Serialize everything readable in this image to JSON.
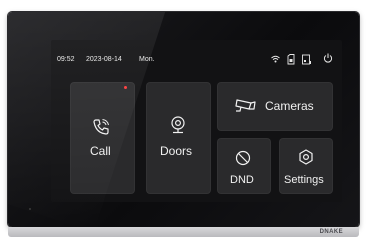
{
  "status_bar": {
    "time": "09:52",
    "date": "2023-08-14",
    "day": "Mon.",
    "icons": [
      "wifi-icon",
      "sd-card-icon",
      "storage-icon",
      "power-icon"
    ]
  },
  "tiles": {
    "call": {
      "label": "Call",
      "icon": "phone-icon",
      "notification": true
    },
    "doors": {
      "label": "Doors",
      "icon": "door-unlock-icon"
    },
    "cameras": {
      "label": "Cameras",
      "icon": "camera-icon"
    },
    "dnd": {
      "label": "DND",
      "icon": "do-not-disturb-icon"
    },
    "settings": {
      "label": "Settings",
      "icon": "gear-icon"
    }
  },
  "brand": {
    "logo_text": "DNAKE"
  },
  "colors": {
    "screen_bg": "#121214",
    "tile_bg": "#2a2a2c",
    "notification_dot": "#ff3b3b"
  }
}
